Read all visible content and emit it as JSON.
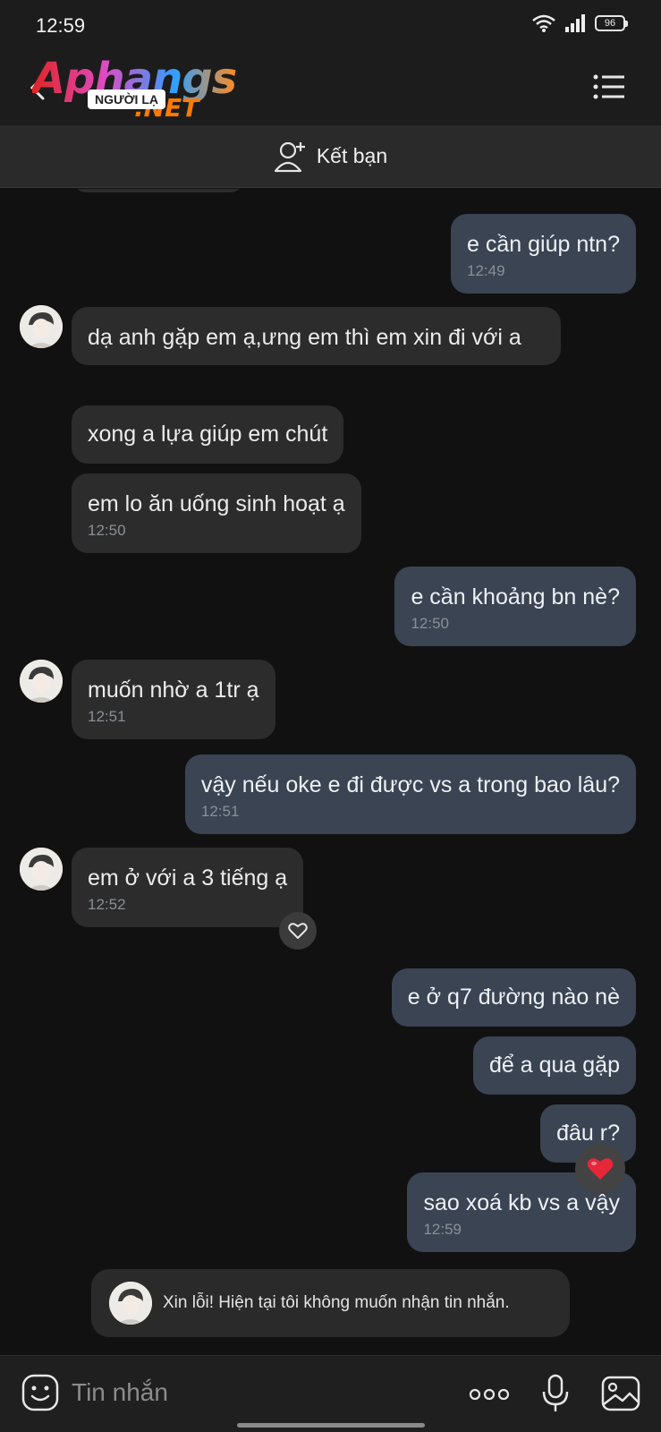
{
  "status_bar": {
    "time": "12:59",
    "battery": "96"
  },
  "header": {
    "logo_text": "Aphangs",
    "logo_net": ".NET",
    "badge": "NGƯỜI LẠ"
  },
  "add_friend": {
    "label": "Kết bạn"
  },
  "messages": [
    {
      "dir": "out",
      "text": "e cần giúp ntn?",
      "time": "12:49"
    },
    {
      "dir": "in",
      "text": "dạ anh gặp em ạ,ưng em thì em xin đi với a",
      "time": ""
    },
    {
      "dir": "in",
      "text": "xong a lựa giúp em chút",
      "time": ""
    },
    {
      "dir": "in",
      "text": "em lo ăn uống sinh hoạt ạ",
      "time": "12:50"
    },
    {
      "dir": "out",
      "text": "e cần khoảng bn nè?",
      "time": "12:50"
    },
    {
      "dir": "in",
      "text": "muốn nhờ a 1tr ạ",
      "time": "12:51"
    },
    {
      "dir": "out",
      "text": "vậy nếu oke e đi được vs a trong bao lâu?",
      "time": "12:51"
    },
    {
      "dir": "in",
      "text": "em ở với a 3 tiếng ạ",
      "time": "12:52"
    },
    {
      "dir": "out",
      "text": "e ở q7 đường nào nè",
      "time": ""
    },
    {
      "dir": "out",
      "text": "để a qua gặp",
      "time": ""
    },
    {
      "dir": "out",
      "text": "đâu r?",
      "time": ""
    },
    {
      "dir": "out",
      "text": "sao xoá kb vs a vậy",
      "time": "12:59"
    }
  ],
  "system_message": {
    "text": "Xin lỗi! Hiện tại tôi không muốn nhận tin nhắn."
  },
  "composer": {
    "placeholder": "Tin nhắn",
    "more": "ooo"
  },
  "colors": {
    "background": "#111111",
    "incoming_bubble": "#2c2c2c",
    "outgoing_bubble": "#3a4453",
    "reaction_heart": "#e8263a"
  }
}
